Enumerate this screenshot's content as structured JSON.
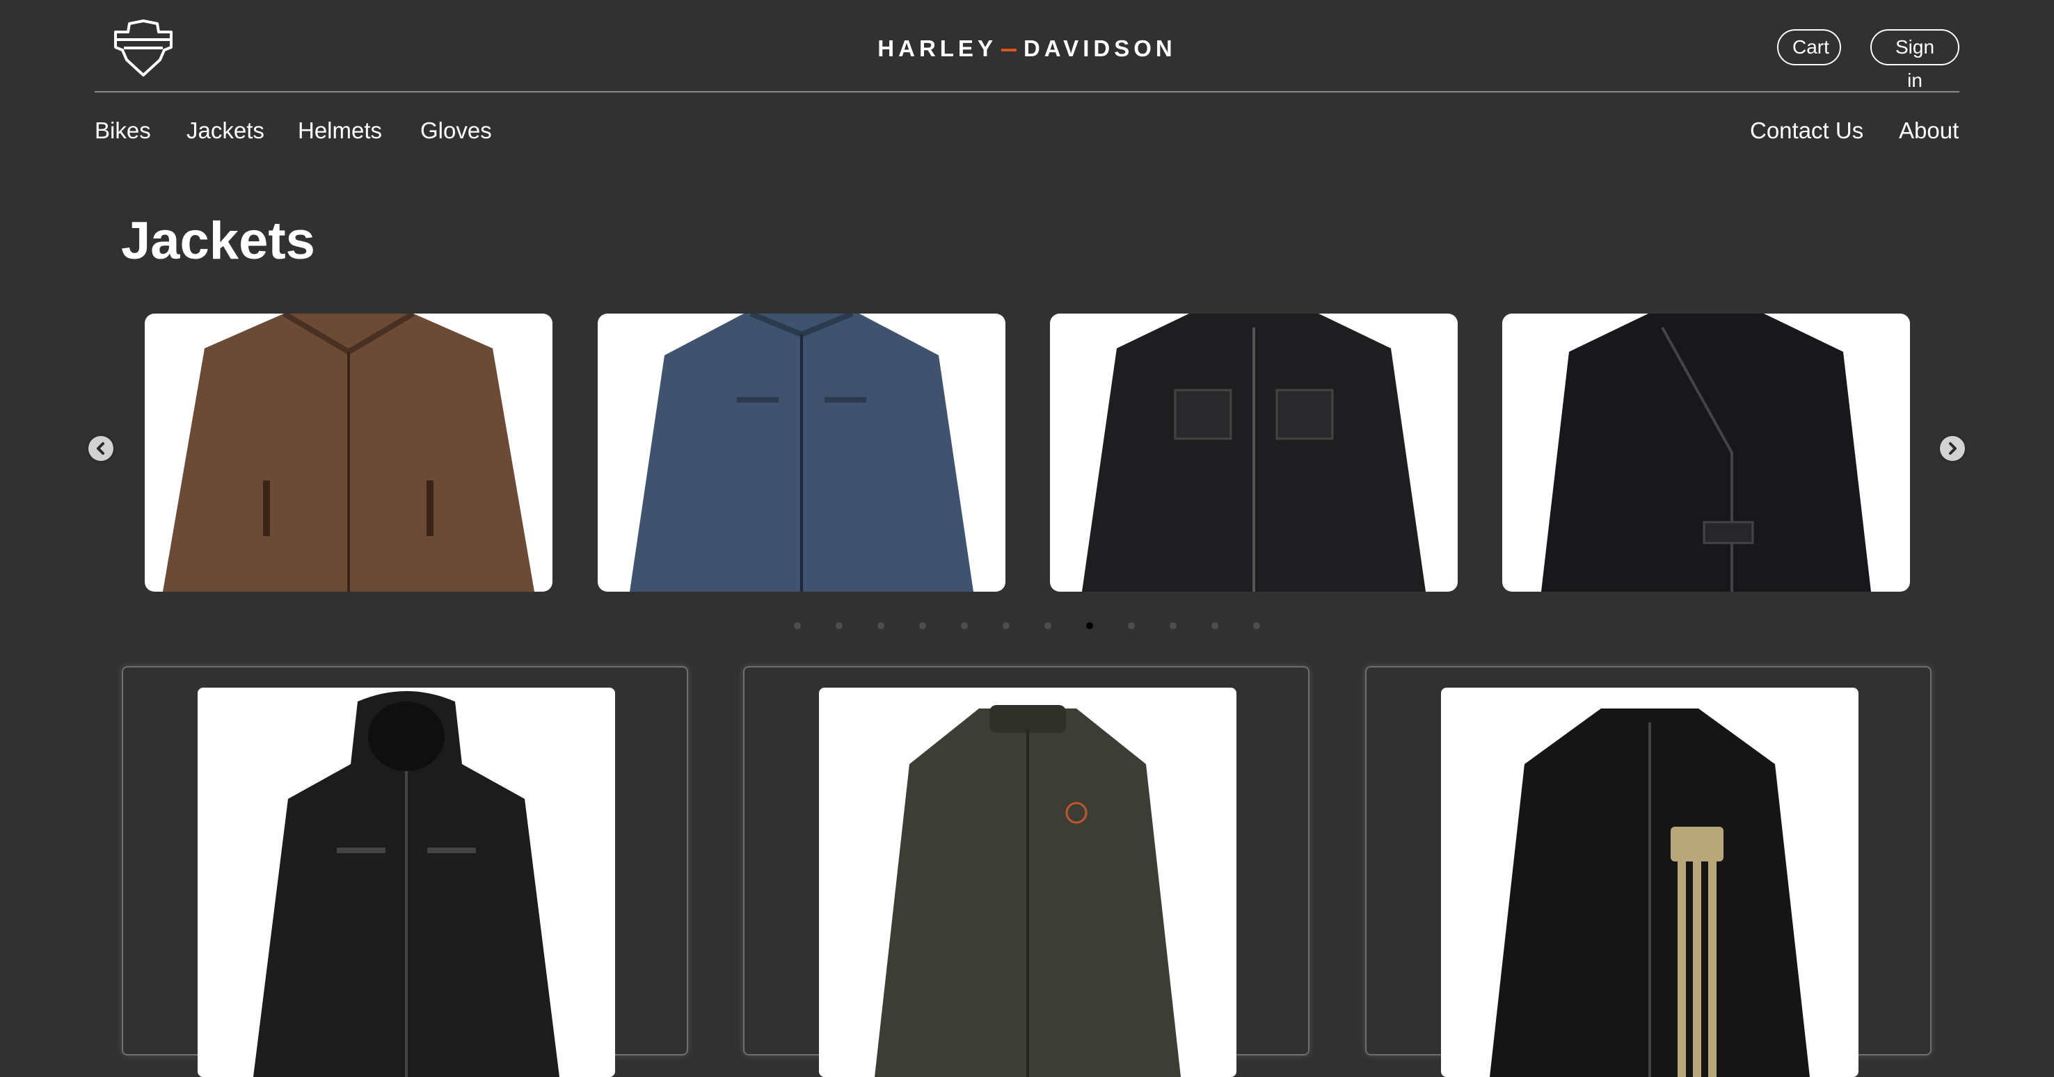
{
  "header": {
    "logo_icon": "bar-and-shield-icon",
    "brand": {
      "left": "HARLEY",
      "right": "DAVIDSON",
      "dash_color": "#e0531f"
    },
    "cart_label": "Cart",
    "signin_label": "Sign in"
  },
  "nav": {
    "left": [
      "Bikes",
      "Jackets",
      "Helmets",
      "Gloves"
    ],
    "right": [
      "Contact Us",
      "About"
    ]
  },
  "page_title": "Jackets",
  "carousel": {
    "items": [
      {
        "name": "Brown distressed leather jacket",
        "color": "#6b4a36"
      },
      {
        "name": "Navy blue leather jacket",
        "color": "#3f536f"
      },
      {
        "name": "Black leather jacket with chest pockets",
        "color": "#1e1e20"
      },
      {
        "name": "Black asymmetric-zip leather jacket",
        "color": "#18181c"
      }
    ],
    "dot_count": 12,
    "active_dot": 7,
    "prev_icon": "chevron-left-icon",
    "next_icon": "chevron-right-icon"
  },
  "products": [
    {
      "name": "Black hooded leather jacket",
      "color": "#1c1c1c"
    },
    {
      "name": "Olive green jacket with orange logo",
      "color": "#3c3d34",
      "accent": "#c0562a"
    },
    {
      "name": "Black leather jacket with tan stripes",
      "color": "#151515",
      "accent": "#b9a77c"
    }
  ],
  "colors": {
    "background": "#313131",
    "text": "#ffffff"
  }
}
